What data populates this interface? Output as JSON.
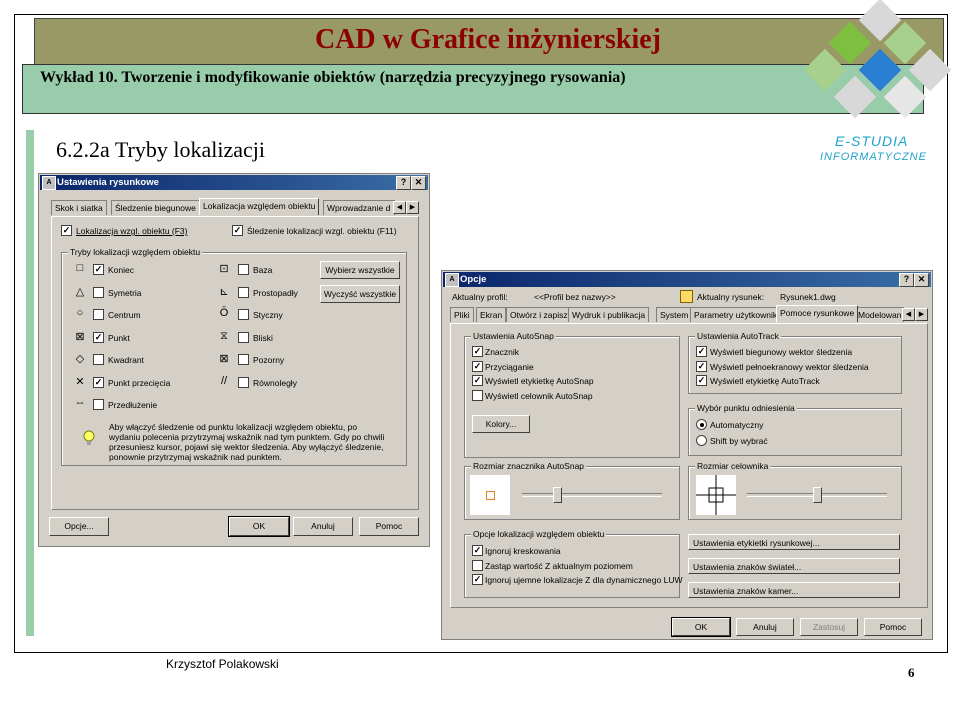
{
  "slide": {
    "title": "CAD w Grafice inżynierskiej",
    "subtitle": "Wykład 10. Tworzenie i modyfikowanie obiektów (narzędzia precyzyjnego rysowania)",
    "section_heading": "6.2.2a Tryby lokalizacji",
    "author": "Krzysztof Polakowski",
    "page_number": "6"
  },
  "logo": {
    "line1": "E-STUDIA",
    "line2": "INFORMATYCZNE",
    "colors": [
      "#7fbf3f",
      "#a8d08d",
      "#2a7fd4",
      "#d0d0d0"
    ]
  },
  "dialog1": {
    "title": "Ustawienia rysunkowe",
    "help_btn": "?",
    "close_btn": "✕",
    "tabs": [
      "Skok i siatka",
      "Śledzenie biegunowe",
      "Lokalizacja względem obiektu",
      "Wprowadzanie d"
    ],
    "osnap_on": "Lokalizacja wzgl. obiektu (F3)",
    "osnap_tracking": "Śledzenie lokalizacji wzgl. obiektu (F11)",
    "group_title": "Tryby lokalizacji względem obiektu",
    "modes_left": [
      {
        "symbol": "□",
        "label": "Koniec",
        "checked": true
      },
      {
        "symbol": "△",
        "label": "Symetria",
        "checked": false
      },
      {
        "symbol": "○",
        "label": "Centrum",
        "checked": false
      },
      {
        "symbol": "⊠",
        "label": "Punkt",
        "checked": true
      },
      {
        "symbol": "◇",
        "label": "Kwadrant",
        "checked": false
      },
      {
        "symbol": "✕",
        "label": "Punkt przecięcia",
        "checked": true
      },
      {
        "symbol": "--",
        "label": "Przedłużenie",
        "checked": false
      }
    ],
    "modes_right": [
      {
        "symbol": "⊡",
        "label": "Baza",
        "checked": false
      },
      {
        "symbol": "⊾",
        "label": "Prostopadły",
        "checked": false
      },
      {
        "symbol": "Ō",
        "label": "Styczny",
        "checked": false
      },
      {
        "symbol": "⧖",
        "label": "Bliski",
        "checked": false
      },
      {
        "symbol": "⊠",
        "label": "Pozorny",
        "checked": false
      },
      {
        "symbol": "//",
        "label": "Równoległy",
        "checked": false
      }
    ],
    "select_all": "Wybierz wszystkie",
    "clear_all": "Wyczyść wszystkie",
    "info_text": "Aby włączyć śledzenie od punktu lokalizacji względem obiektu, po wydaniu polecenia przytrzymaj wskaźnik nad tym punktem. Gdy po chwili przesuniesz kursor, pojawi się wektor śledzenia. Aby wyłączyć śledzenie, ponownie przytrzymaj wskaźnik nad punktem.",
    "options_btn": "Opcje...",
    "ok_btn": "OK",
    "cancel_btn": "Anuluj",
    "help_button": "Pomoc"
  },
  "dialog2": {
    "title": "Opcje",
    "help_btn": "?",
    "close_btn": "✕",
    "current_profile_label": "Aktualny profil:",
    "current_profile_value": "<<Profil bez nazwy>>",
    "current_drawing_label": "Aktualny rysunek:",
    "current_drawing_value": "Rysunek1.dwg",
    "tabs": [
      "Pliki",
      "Ekran",
      "Otwórz i zapisz",
      "Wydruk i publikacja",
      "System",
      "Parametry użytkownika",
      "Pomoce rysunkowe",
      "Modelowan"
    ],
    "autosnap_group": "Ustawienia AutoSnap",
    "autosnap": [
      {
        "label": "Znacznik",
        "checked": true
      },
      {
        "label": "Przyciąganie",
        "checked": true
      },
      {
        "label": "Wyświetl etykietkę AutoSnap",
        "checked": true
      },
      {
        "label": "Wyświetl celownik AutoSnap",
        "checked": false
      }
    ],
    "colors_btn": "Kolory...",
    "autotrack_group": "Ustawienia AutoTrack",
    "autotrack": [
      {
        "label": "Wyświetl biegunowy wektor śledzenia",
        "checked": true
      },
      {
        "label": "Wyświetl pełnoekranowy wektor śledzenia",
        "checked": true
      },
      {
        "label": "Wyświetl etykietkę AutoTrack",
        "checked": true
      }
    ],
    "alignment_group": "Wybór punktu odniesienia",
    "alignment": [
      {
        "label": "Automatyczny",
        "selected": true
      },
      {
        "label": "Shift by wybrać",
        "selected": false
      }
    ],
    "marker_size_group": "Rozmiar znacznika AutoSnap",
    "marker_size_level": 0.25,
    "aperture_size_group": "Rozmiar celownika",
    "aperture_size_level": 0.5,
    "osnap_options_group": "Opcje lokalizacji względem obiektu",
    "osnap_options": [
      {
        "label": "Ignoruj kreskowania",
        "checked": true
      },
      {
        "label": "Zastąp wartość Z aktualnym poziomem",
        "checked": false
      },
      {
        "label": "Ignoruj ujemne lokalizacje Z dla dynamicznego LUW",
        "checked": true
      }
    ],
    "btn_drafting_tooltip": "Ustawienia etykietki rysunkowej...",
    "btn_lights": "Ustawienia znaków świateł...",
    "btn_cameras": "Ustawienia znaków kamer...",
    "ok_btn": "OK",
    "cancel_btn": "Anuluj",
    "apply_btn": "Zastosuj",
    "help_button": "Pomoc"
  }
}
